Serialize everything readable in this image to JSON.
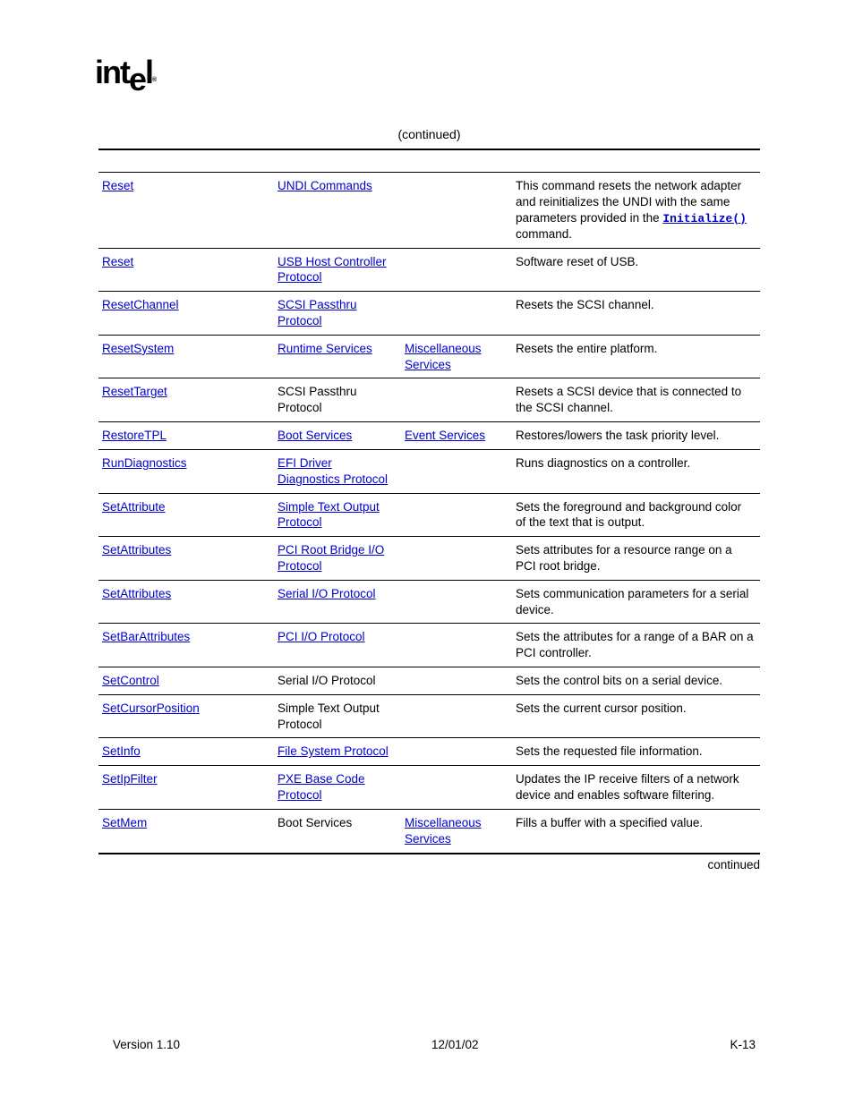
{
  "caption": "(continued)",
  "continued_note": "continued",
  "footer": {
    "left": "Version 1.10",
    "center": "12/01/02",
    "right": "K-13"
  },
  "rows": [
    {
      "c1": {
        "text": "Reset",
        "link": true
      },
      "c2": {
        "text": "UNDI Commands",
        "link": true
      },
      "c3": {
        "text": "",
        "link": false
      },
      "c4_pre": "This command resets the network adapter and reinitializes the UNDI with the same parameters provided in the ",
      "c4_code": "Initialize()",
      "c4_post": " command."
    },
    {
      "c1": {
        "text": "Reset",
        "link": true
      },
      "c2": {
        "text": "USB Host Controller Protocol",
        "link": true
      },
      "c3": {
        "text": "",
        "link": false
      },
      "c4": "Software reset of USB."
    },
    {
      "c1": {
        "text": "ResetChannel",
        "link": true
      },
      "c2": {
        "text": "SCSI Passthru Protocol",
        "link": true
      },
      "c3": {
        "text": "",
        "link": false
      },
      "c4": "Resets the SCSI channel."
    },
    {
      "c1": {
        "text": "ResetSystem",
        "link": true
      },
      "c2": {
        "text": "Runtime Services",
        "link": true
      },
      "c3": {
        "text": "Miscellaneous Services",
        "link": true
      },
      "c4": "Resets the entire platform."
    },
    {
      "c1": {
        "text": "ResetTarget",
        "link": true
      },
      "c2": {
        "text": "SCSI Passthru Protocol",
        "link": false
      },
      "c3": {
        "text": "",
        "link": false
      },
      "c4": "Resets a SCSI device that is connected to the SCSI channel."
    },
    {
      "c1": {
        "text": "RestoreTPL",
        "link": true
      },
      "c2": {
        "text": "Boot Services",
        "link": true
      },
      "c3": {
        "text": "Event Services",
        "link": true
      },
      "c4": "Restores/lowers the task priority level."
    },
    {
      "c1": {
        "text": "RunDiagnostics",
        "link": true
      },
      "c2": {
        "text": "EFI Driver Diagnostics Protocol",
        "link": true
      },
      "c3": {
        "text": "",
        "link": false
      },
      "c4": "Runs diagnostics on a controller."
    },
    {
      "c1": {
        "text": "SetAttribute",
        "link": true
      },
      "c2": {
        "text": "Simple Text Output Protocol",
        "link": true
      },
      "c3": {
        "text": "",
        "link": false
      },
      "c4": "Sets the foreground and background color of the text that is output."
    },
    {
      "c1": {
        "text": "SetAttributes",
        "link": true
      },
      "c2": {
        "text": "PCI Root Bridge I/O Protocol",
        "link": true
      },
      "c3": {
        "text": "",
        "link": false
      },
      "c4": "Sets attributes for a resource range on a PCI root bridge."
    },
    {
      "c1": {
        "text": "SetAttributes",
        "link": true
      },
      "c2": {
        "text": "Serial I/O Protocol",
        "link": true
      },
      "c3": {
        "text": "",
        "link": false
      },
      "c4": "Sets communication parameters for a serial device."
    },
    {
      "c1": {
        "text": "SetBarAttributes",
        "link": true
      },
      "c2": {
        "text": "PCI I/O Protocol",
        "link": true
      },
      "c3": {
        "text": "",
        "link": false
      },
      "c4": "Sets the attributes for a range of a BAR on a PCI controller."
    },
    {
      "c1": {
        "text": "SetControl",
        "link": true
      },
      "c2": {
        "text": "Serial I/O Protocol",
        "link": false
      },
      "c3": {
        "text": "",
        "link": false
      },
      "c4": "Sets the control bits on a serial device."
    },
    {
      "c1": {
        "text": "SetCursorPosition",
        "link": true
      },
      "c2": {
        "text": "Simple Text Output Protocol",
        "link": false
      },
      "c3": {
        "text": "",
        "link": false
      },
      "c4": "Sets the current cursor position."
    },
    {
      "c1": {
        "text": "SetInfo",
        "link": true
      },
      "c2": {
        "text": "File System Protocol",
        "link": true
      },
      "c3": {
        "text": "",
        "link": false
      },
      "c4": "Sets the requested file information."
    },
    {
      "c1": {
        "text": "SetIpFilter",
        "link": true
      },
      "c2": {
        "text": "PXE Base Code Protocol",
        "link": true
      },
      "c3": {
        "text": "",
        "link": false
      },
      "c4": "Updates the IP receive filters of a network device and enables software filtering."
    },
    {
      "c1": {
        "text": "SetMem",
        "link": true
      },
      "c2": {
        "text": "Boot Services",
        "link": false
      },
      "c3": {
        "text": "Miscellaneous Services",
        "link": true
      },
      "c4": "Fills a buffer with a specified value."
    }
  ]
}
